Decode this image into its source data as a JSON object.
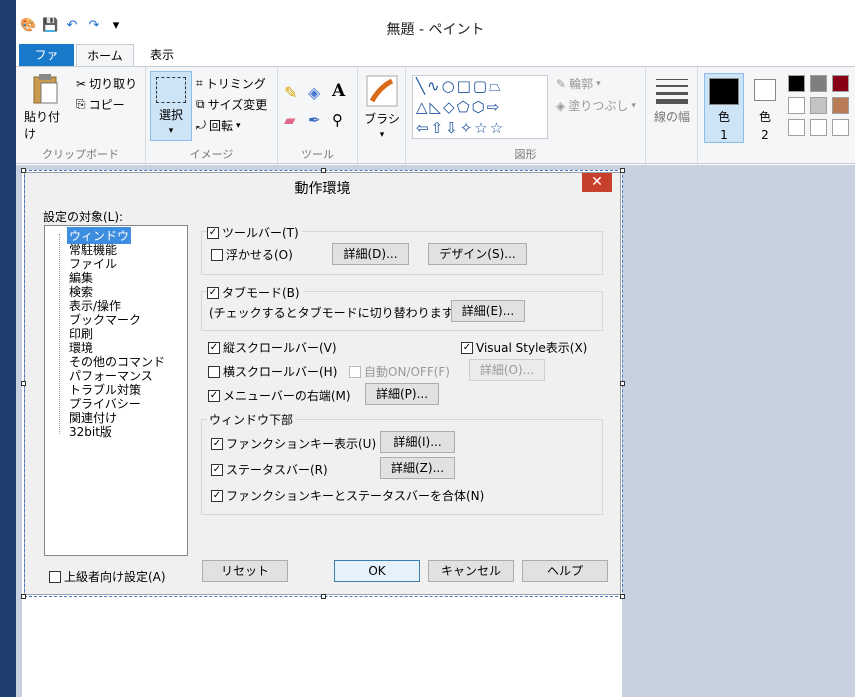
{
  "window": {
    "title": "無題 - ペイント"
  },
  "ribbon": {
    "tabs": [
      "ファイル",
      "ホーム",
      "表示"
    ],
    "clipboard": {
      "paste": "貼り付け",
      "cut": "切り取り",
      "copy": "コピー",
      "label": "クリップボード"
    },
    "image": {
      "select": "選択",
      "crop": "トリミング",
      "resize": "サイズ変更",
      "rotate": "回転",
      "label": "イメージ"
    },
    "tools": {
      "label": "ツール"
    },
    "brush": {
      "label": "ブラシ"
    },
    "shapes": {
      "outline": "輪郭",
      "fill": "塗りつぶし",
      "label": "図形"
    },
    "size": {
      "label": "線の幅"
    },
    "color1": {
      "label": "色",
      "num": "1"
    },
    "color2": {
      "label": "色",
      "num": "2"
    },
    "palette": [
      "#000000",
      "#7f7f7f",
      "#880015",
      "#ffffff",
      "#c3c3c3",
      "#b97a57",
      "#ffffff",
      "#ffffff",
      "#ffffff"
    ]
  },
  "dialog": {
    "title": "動作環境",
    "close": "✕",
    "target_label": "設定の対象(L):",
    "tree": [
      "ウィンドウ",
      "常駐機能",
      "ファイル",
      "編集",
      "検索",
      "表示/操作",
      "ブックマーク",
      "印刷",
      "環境",
      "その他のコマンド",
      "パフォーマンス",
      "トラブル対策",
      "プライバシー",
      "関連付け",
      "32bit版"
    ],
    "toolbar": {
      "label": "ツールバー(T)",
      "checked": true,
      "float_label": "浮かせる(O)",
      "float_checked": false,
      "detail": "詳細(D)...",
      "design": "デザイン(S)..."
    },
    "tabmode": {
      "label": "タブモード(B)",
      "checked": true,
      "desc": "(チェックするとタブモードに切り替わります)",
      "detail": "詳細(E)..."
    },
    "vscroll": {
      "label": "縦スクロールバー(V)",
      "checked": true
    },
    "visualstyle": {
      "label": "Visual Style表示(X)",
      "checked": true
    },
    "hscroll": {
      "label": "横スクロールバー(H)",
      "checked": false
    },
    "autoonoff": {
      "label": "自動ON/OFF(F)",
      "checked": false
    },
    "hscroll_detail": "詳細(O)...",
    "menubar": {
      "label": "メニューバーの右端(M)",
      "checked": true,
      "detail": "詳細(P)..."
    },
    "bottom": {
      "label": "ウィンドウ下部",
      "fkey": {
        "label": "ファンクションキー表示(U)",
        "checked": true,
        "detail": "詳細(I)..."
      },
      "status": {
        "label": "ステータスバー(R)",
        "checked": true,
        "detail": "詳細(Z)..."
      },
      "merge": {
        "label": "ファンクションキーとステータスバーを合体(N)",
        "checked": true
      }
    },
    "advanced": {
      "label": "上級者向け設定(A)",
      "checked": false
    },
    "buttons": {
      "reset": "リセット",
      "ok": "OK",
      "cancel": "キャンセル",
      "help": "ヘルプ"
    }
  }
}
